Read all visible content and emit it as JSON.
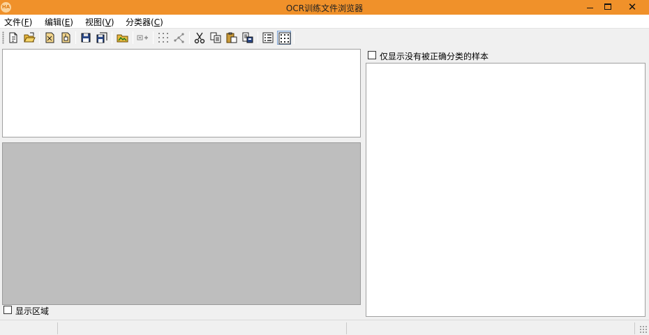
{
  "window": {
    "title": "OCR训练文件浏览器",
    "app_icon_text": "HA",
    "close_glyph": "✕",
    "accent": "#f0912a"
  },
  "menu": [
    {
      "label": "文件(",
      "key": "F",
      "tail": ")"
    },
    {
      "label": "编辑(",
      "key": "E",
      "tail": ")"
    },
    {
      "label": "视图(",
      "key": "V",
      "tail": ")"
    },
    {
      "label": "分类器(",
      "key": "C",
      "tail": ")"
    }
  ],
  "toolbar": {
    "icons": [
      "new-file-icon",
      "open-folder-icon",
      "edit-doc-icon",
      "export-doc-icon",
      "save-icon",
      "save-all-icon",
      "open-image-icon",
      "add-region-icon",
      "abc-grid-icon",
      "network-icon",
      "cut-icon",
      "copy-icon",
      "paste-icon",
      "properties-icon",
      "list-view-icon",
      "grid-view-icon"
    ],
    "pressed": "grid-view-icon"
  },
  "left": {
    "show_region_label": "显示区域",
    "show_region_checked": false
  },
  "right": {
    "misclassified_label": "仅显示没有被正确分类的样本",
    "misclassified_checked": false
  }
}
